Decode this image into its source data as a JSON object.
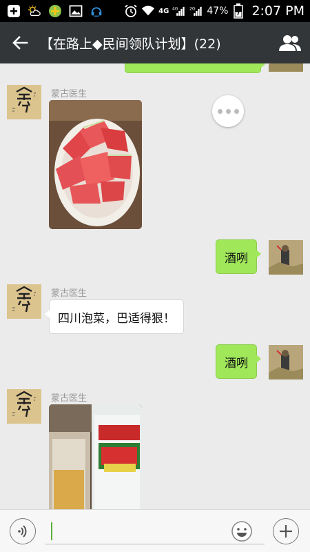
{
  "status_bar": {
    "network_label": "4G",
    "sim1_label": "4G",
    "sim2_label": "2G",
    "battery_percent": "47%",
    "time": "2:07 PM",
    "icons": [
      "add-icon",
      "weather-icon",
      "app-icon",
      "gallery-icon",
      "headset-icon",
      "alarm-icon",
      "wifi-icon",
      "signal-icon",
      "battery-icon"
    ]
  },
  "header": {
    "title": "【在路上◆民间领队计划】(22)",
    "back_icon": "arrow-left-icon",
    "group_icon": "people-icon"
  },
  "messages": [
    {
      "side": "in",
      "sender": "蒙古医生",
      "type": "image",
      "image_desc": "watermelon-plate"
    },
    {
      "side": "out",
      "type": "text",
      "text": "酒咧"
    },
    {
      "side": "in",
      "sender": "蒙古医生",
      "type": "text",
      "text": "四川泡菜，巴适得狠！"
    },
    {
      "side": "out",
      "type": "text",
      "text": "酒咧"
    },
    {
      "side": "in",
      "sender": "蒙古医生",
      "type": "image",
      "image_desc": "beer-bottle-and-glass"
    }
  ],
  "input_bar": {
    "placeholder": "",
    "voice_icon": "voice-icon",
    "emoji_icon": "emoji-icon",
    "plus_icon": "plus-icon"
  },
  "colors": {
    "header_bg": "#333639",
    "chat_bg": "#ebebeb",
    "outgoing_bubble": "#a0e75a",
    "incoming_bubble": "#ffffff"
  }
}
